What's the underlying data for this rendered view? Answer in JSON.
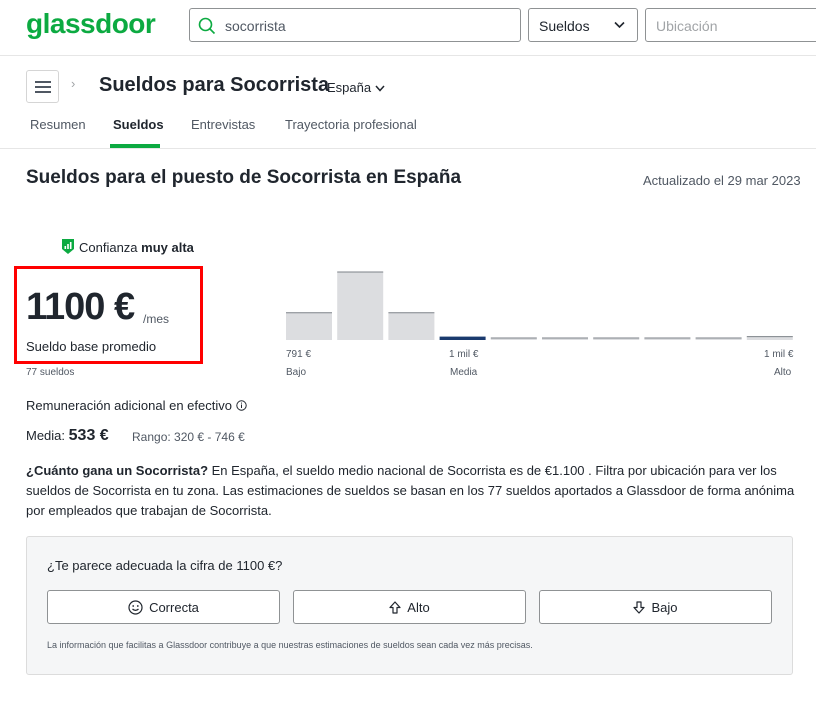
{
  "header": {
    "logo": "glassdoor",
    "search_value": "socorrista",
    "category_select": "Sueldos",
    "location_placeholder": "Ubicación"
  },
  "title_row": {
    "breadcrumb_sep": "›",
    "title": "Sueldos para Socorrista",
    "country": "España"
  },
  "tabs": [
    {
      "label": "Resumen"
    },
    {
      "label": "Sueldos"
    },
    {
      "label": "Entrevistas"
    },
    {
      "label": "Trayectoria profesional"
    }
  ],
  "main": {
    "section_title": "Sueldos para el puesto de Socorrista en España",
    "updated": "Actualizado el 29 mar 2023",
    "confidence_prefix": "Confianza",
    "confidence_level": "muy alta",
    "average_value": "1100 €",
    "average_unit": "/mes",
    "average_label": "Sueldo base promedio",
    "salary_count": "77 sueldos",
    "additional_title": "Remuneración adicional en efectivo",
    "median_label": "Media:",
    "median_value": "533 €",
    "range_text": "Rango: 320 € - 746 €",
    "desc_question": "¿Cuánto gana un Socorrista?",
    "desc_body": " En España, el sueldo medio nacional de Socorrista es de €1.100 . Filtra por ubicación para ver los sueldos de Socorrista en tu zona. Las estimaciones de sueldos se basan en los 77 sueldos aportados a Glassdoor de forma anónima por empleados que trabajan de Socorrista."
  },
  "chart_data": {
    "type": "bar",
    "title": "",
    "x_labels": {
      "left": "791 €",
      "mid": "1 mil €",
      "right": "1 mil €"
    },
    "x_captions": {
      "left": "Bajo",
      "mid": "Media",
      "right": "Alto"
    },
    "values": [
      4,
      10,
      4,
      0.5,
      0.2,
      0.2,
      0.2,
      0.2,
      0.2,
      0.5
    ],
    "highlight_index": 3,
    "colors": {
      "bar": "#dcdde0",
      "bar_edge": "#7d8288",
      "highlight": "#1a3a6e"
    }
  },
  "feedback": {
    "question": "¿Te parece adecuada la cifra de 1100 €?",
    "correct": "Correcta",
    "high": "Alto",
    "low": "Bajo",
    "note": "La información que facilitas a Glassdoor contribuye a que nuestras estimaciones de sueldos sean cada vez más precisas."
  },
  "colors": {
    "brand": "#0caa41",
    "highlight_box": "#ff0000"
  }
}
